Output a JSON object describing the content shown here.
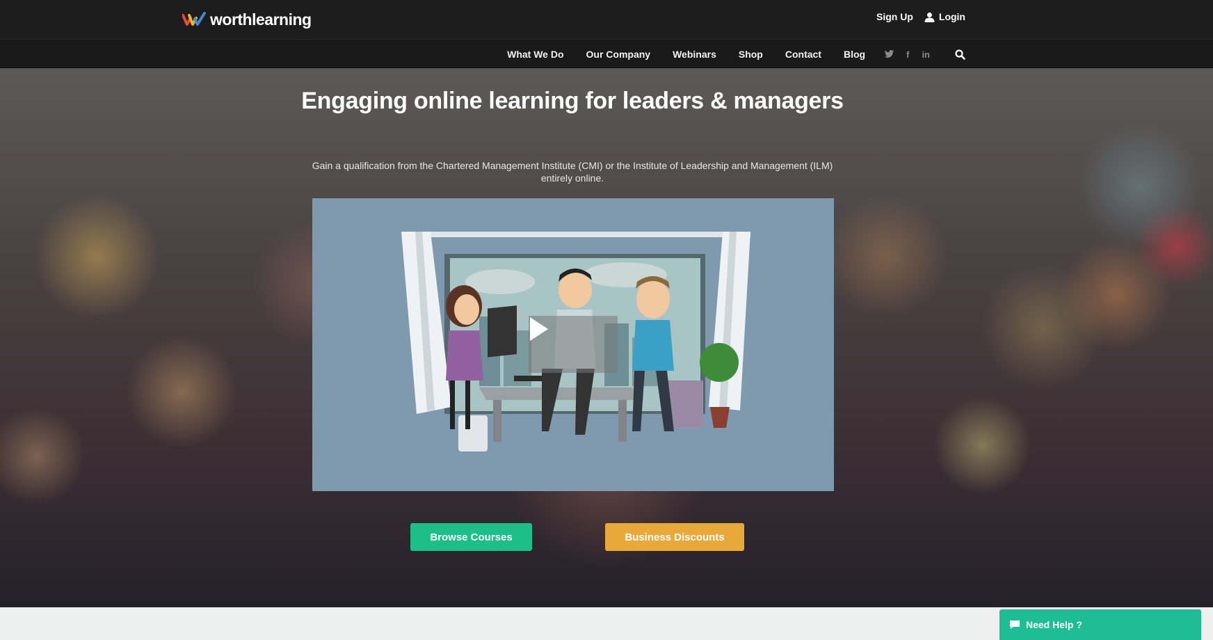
{
  "header": {
    "brand": "worthlearning",
    "logo_icon": "w-tick-logo",
    "signup_label": "Sign Up",
    "login_label": "Login",
    "login_icon": "user-icon"
  },
  "nav": {
    "items": [
      {
        "label": "What We Do"
      },
      {
        "label": "Our Company"
      },
      {
        "label": "Webinars"
      },
      {
        "label": "Shop"
      },
      {
        "label": "Contact"
      },
      {
        "label": "Blog"
      }
    ],
    "social": {
      "twitter": "𝕏",
      "facebook": "f",
      "linkedin": "in"
    },
    "search_icon": "search-icon"
  },
  "hero": {
    "title": "Engaging online learning for leaders & managers",
    "subtitle": "Gain a qualification from the Chartered Management Institute (CMI) or the Institute of Leadership and Management (ILM) entirely online.",
    "video_icon": "play-icon",
    "browse_label": "Browse Courses",
    "business_label": "Business Discounts"
  },
  "help": {
    "label": "Need Help ?",
    "icon": "chat-bubble-icon"
  },
  "colors": {
    "accent_green": "#1bbf87",
    "accent_orange": "#e9a83a",
    "help_green": "#1fbd94",
    "header_bg": "#1d1d1d"
  }
}
